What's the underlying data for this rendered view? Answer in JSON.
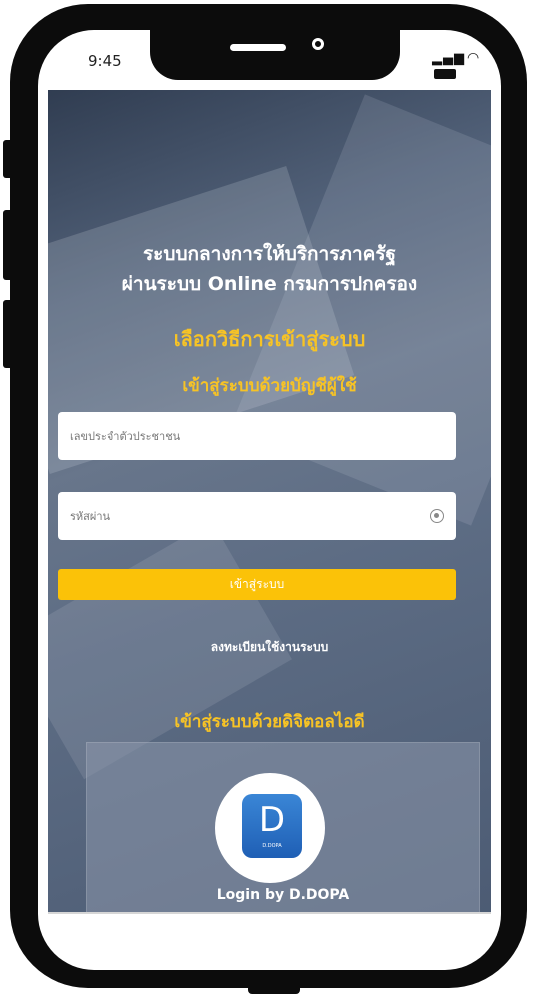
{
  "status_bar": {
    "time": "9:45"
  },
  "header": {
    "title_line1": "ระบบกลางการให้บริการภาครัฐ",
    "title_line2": "ผ่านระบบ Online กรมการปกครอง",
    "choose_login": "เลือกวิธีการเข้าสู่ระบบ",
    "account_login": "เข้าสู่ระบบด้วยบัญชีผู้ใช้"
  },
  "form": {
    "id_placeholder": "เลขประจำตัวประชาชน",
    "password_placeholder": "รหัสผ่าน",
    "login_label": "เข้าสู่ระบบ",
    "register_label": "ลงทะเบียนใช้งานระบบ"
  },
  "dopa": {
    "section_title": "เข้าสู่ระบบด้วยดิจิตอลไอดี",
    "app_letter": "D",
    "app_small": "D.DOPA",
    "caption": "Login by D.DOPA"
  },
  "colors": {
    "accent": "#fbc208",
    "heading_yellow": "#f7c325",
    "app_blue": "#2a72c8"
  }
}
